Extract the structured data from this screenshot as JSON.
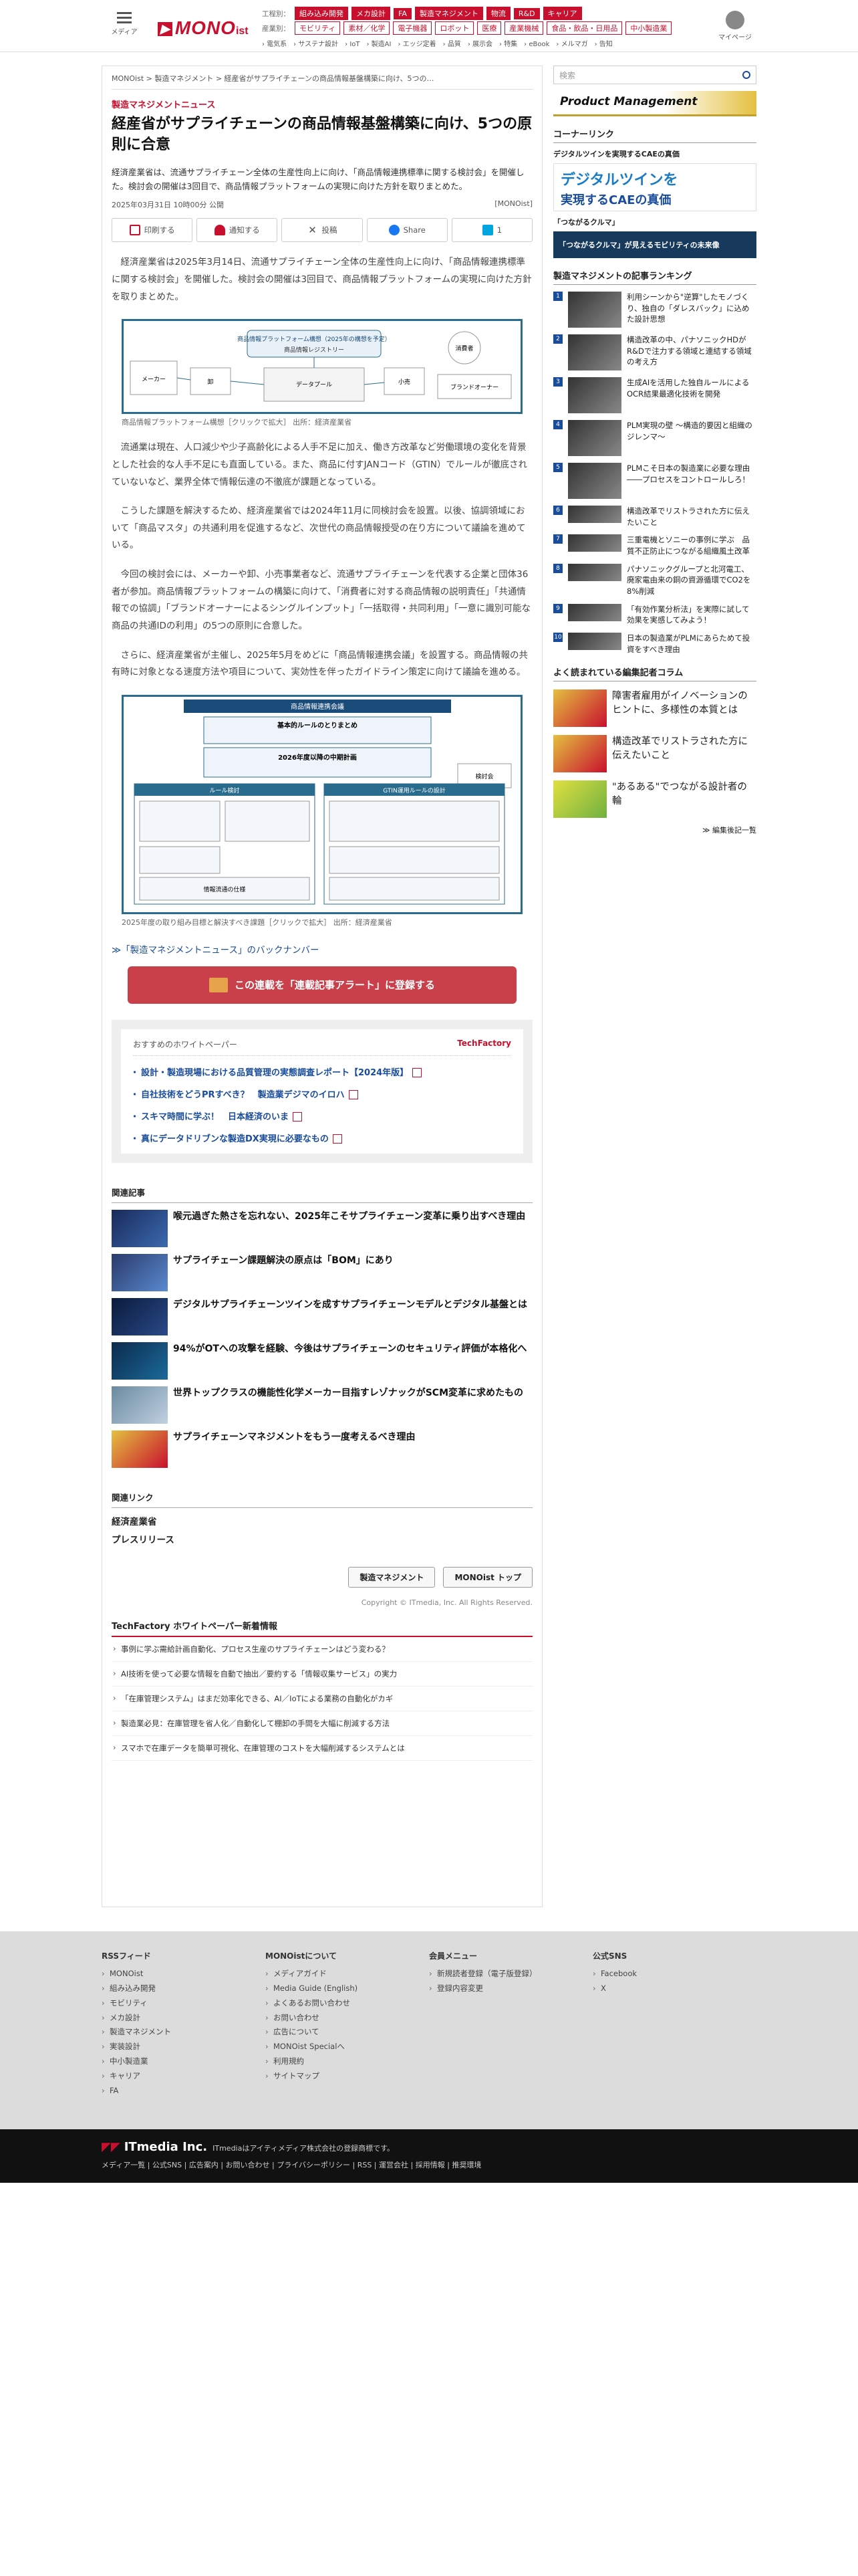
{
  "header": {
    "menu_label": "メディア",
    "logo": {
      "prefix": "",
      "mono": "MONO",
      "ist": "ist"
    },
    "nav1_label": "工程別：",
    "nav1": [
      "組み込み開発",
      "メカ設計",
      "FA",
      "製造マネジメント",
      "物流",
      "R&D",
      "キャリア"
    ],
    "nav1_active": "製造マネジメント",
    "nav2_label": "産業別：",
    "nav2": [
      "モビリティ",
      "素材／化学",
      "電子機器",
      "ロボット",
      "医療",
      "産業機械",
      "食品・飲品・日用品",
      "中小製造業"
    ],
    "nav3": "› 電気系　› サステナ設計　› IoT　› 製造AI　› エッジ定着　› 品質　› 展示会　› 特集　› eBook　› メルマガ　› 告知",
    "user_label": "マイページ"
  },
  "breadcrumb": "MONOist > 製造マネジメント > 経産省がサプライチェーンの商品情報基盤構築に向け、5つの…",
  "article": {
    "category": "製造マネジメントニュース",
    "title": "経産省がサプライチェーンの商品情報基盤構築に向け、5つの原則に合意",
    "lead": "経済産業省は、流通サプライチェーン全体の生産性向上に向け、「商品情報連携標準に関する検討会」を開催した。検討会の開催は3回目で、商品情報プラットフォームの実現に向けた方針を取りまとめた。",
    "date": "2025年03月31日 10時00分 公開",
    "source": "[MONOist]",
    "share": {
      "print": "印刷する",
      "bookmark": "通知する",
      "x": "投稿",
      "facebook": "Share",
      "count": "1"
    },
    "paragraphs": [
      "経済産業省は2025年3月14日、流通サプライチェーン全体の生産性向上に向け、「商品情報連携標準に関する検討会」を開催した。検討会の開催は3回目で、商品情報プラットフォームの実現に向けた方針を取りまとめた。",
      "流通業は現在、人口減少や少子高齢化による人手不足に加え、働き方改革など労働環境の変化を背景とした社会的な人手不足にも直面している。また、商品に付すJANコード（GTIN）でルールが徹底されていないなど、業界全体で情報伝達の不徹底が課題となっている。",
      "こうした課題を解決するため、経済産業省では2024年11月に同検討会を設置。以後、協調領域において「商品マスタ」の共通利用を促進するなど、次世代の商品情報授受の在り方について議論を進めている。",
      "今回の検討会には、メーカーや卸、小売事業者など、流通サプライチェーンを代表する企業と団体36者が参加。商品情報プラットフォームの構築に向けて、「消費者に対する商品情報の説明責任」「共通情報での協調」「ブランドオーナーによるシングルインプット」「一括取得・共同利用」「一意に識別可能な商品の共通IDの利用」の5つの原則に合意した。",
      "さらに、経済産業省が主催し、2025年5月をめどに「商品情報連携会議」を設置する。商品情報の共有時に対象となる速度方法や項目について、実効性を伴ったガイドライン策定に向けて議論を進める。"
    ],
    "figure1": {
      "caption": "商品情報プラットフォーム構想［クリックで拡大］ 出所：経済産業省",
      "title": "商品情報プラットフォーム構想（2025年の構想を予定）",
      "labels": [
        "消費者",
        "メーカー",
        "卸",
        "小売",
        "商品情報レジストリー",
        "データプール",
        "ブランドオーナー"
      ]
    },
    "figure2": {
      "caption": "2025年度の取り組み目標と解決すべき課題［クリックで拡大］ 出所：経済産業省",
      "title": "商品情報連携会議",
      "boxes": [
        "基本的ルールのとりまとめ",
        "2026年度以降の中期計画",
        "ルール検討",
        "GTIN運用ルールの設計",
        "情報流通の仕様",
        "検討会"
      ]
    },
    "backnumber": "≫「製造マネジメントニュース」のバックナンバー",
    "alert_button": "この連載を「連載記事アラート」に登録する"
  },
  "whitepaper": {
    "heading": "おすすめのホワイトペーパー",
    "brand": "TechFactory",
    "items": [
      "設計・製造現場における品質管理の実態調査レポート【2024年版】",
      "自社技術をどうPRすべき？　製造業デジマのイロハ",
      "スキマ時間に学ぶ！　日本経済のいま",
      "真にデータドリブンな製造DX実現に必要なもの"
    ]
  },
  "related": {
    "heading": "関連記事",
    "items": [
      "喉元過ぎた熱さを忘れない、2025年こそサプライチェーン変革に乗り出すべき理由",
      "サプライチェーン課題解決の原点は「BOM」にあり",
      "デジタルサプライチェーンツインを成すサプライチェーンモデルとデジタル基盤とは",
      "94%がOTへの攻撃を経験、今後はサプライチェーンのセキュリティ評価が本格化へ",
      "世界トップクラスの機能性化学メーカー目指すレゾナックがSCM変革に求めたもの",
      "サプライチェーンマネジメントをもう一度考えるべき理由"
    ]
  },
  "related_links": {
    "heading": "関連リンク",
    "items": [
      "経済産業省",
      "プレスリリース"
    ]
  },
  "buttons": {
    "category": "製造マネジメント",
    "top": "MONOist トップ"
  },
  "copyright": "Copyright © ITmedia, Inc. All Rights Reserved.",
  "techfactory": {
    "heading": "TechFactory ホワイトペーパー新着情報",
    "items": [
      "事例に学ぶ需給計画自動化、プロセス生産のサプライチェーンはどう変わる？",
      "AI技術を使って必要な情報を自動で抽出／要約する「情報収集サービス」の実力",
      "「在庫管理システム」はまだ効率化できる、AI／IoTによる業務の自動化がカギ",
      "製造業必見：在庫管理を省人化／自動化して棚卸の手間を大幅に削減する方法",
      "スマホで在庫データを簡単可視化、在庫管理のコストを大幅削減するシステムとは"
    ]
  },
  "sidebar": {
    "search_placeholder": "検索",
    "banner": "Product Management",
    "corner_link": "コーナーリンク",
    "link1": "デジタルツインを実現するCAEの真価",
    "ad1_line1": "デジタルツインを",
    "ad1_line2": "実現するCAEの真価",
    "link2": "「つながるクルマ」",
    "ad2": "「つながるクルマ」が見えるモビリティの未来像",
    "ranking_heading": "製造マネジメントの記事ランキング",
    "ranking": [
      "利用シーンから\"逆算\"したモノづくり、独自の「ダレスバック」に込めた設計思想",
      "構造改革の中、パナソニックHDがR&Dで注力する領域と連結する領域の考え方",
      "生成AIを活用した独自ルールによるOCR結果最適化技術を開発",
      "PLM実現の壁 〜構造的要因と組織のジレンマ〜",
      "PLMこそ日本の製造業に必要な理由――プロセスをコントロールしろ！",
      "構造改革でリストラされた方に伝えたいこと",
      "三重電機とソニーの事例に学ぶ　品質不正防止につながる組織風土改革",
      "パナソニックグループと北河電工、廃家電由来の銅の資源循環でCO2を8%削減",
      "「有効作業分析法」を実際に試して効果を実感してみよう！",
      "日本の製造業がPLMにあらためて投資をすべき理由"
    ],
    "columns_heading": "よく読まれている編集記者コラム",
    "columns": [
      "障害者雇用がイノベーションのヒントに、多様性の本質とは",
      "構造改革でリストラされた方に伝えたいこと",
      "\"あるある\"でつながる設計者の輪"
    ],
    "more": "≫ 編集後記一覧"
  },
  "footer": {
    "cols": [
      {
        "title": "RSSフィード",
        "items": [
          "MONOist",
          "組み込み開発",
          "モビリティ",
          "メカ設計",
          "製造マネジメント",
          "実装設計",
          "中小製造業",
          "キャリア",
          "FA"
        ]
      },
      {
        "title": "MONOistについて",
        "items": [
          "メディアガイド",
          "Media Guide (English)",
          "よくあるお問い合わせ",
          "お問い合わせ",
          "広告について",
          "MONOist Specialへ",
          "利用規約",
          "サイトマップ"
        ]
      },
      {
        "title": "会員メニュー",
        "items": [
          "新規読者登録（電子版登録）",
          "登録内容変更"
        ]
      },
      {
        "title": "公式SNS",
        "items": [
          "Facebook",
          "X"
        ]
      }
    ],
    "company": "ITmedia Inc.",
    "company_note": "ITmediaはアイティメディア株式会社の登録商標です。",
    "links": "メディア一覧 | 公式SNS | 広告案内 | お問い合わせ | プライバシーポリシー | RSS | 運営会社 | 採用情報 | 推奨環境"
  }
}
